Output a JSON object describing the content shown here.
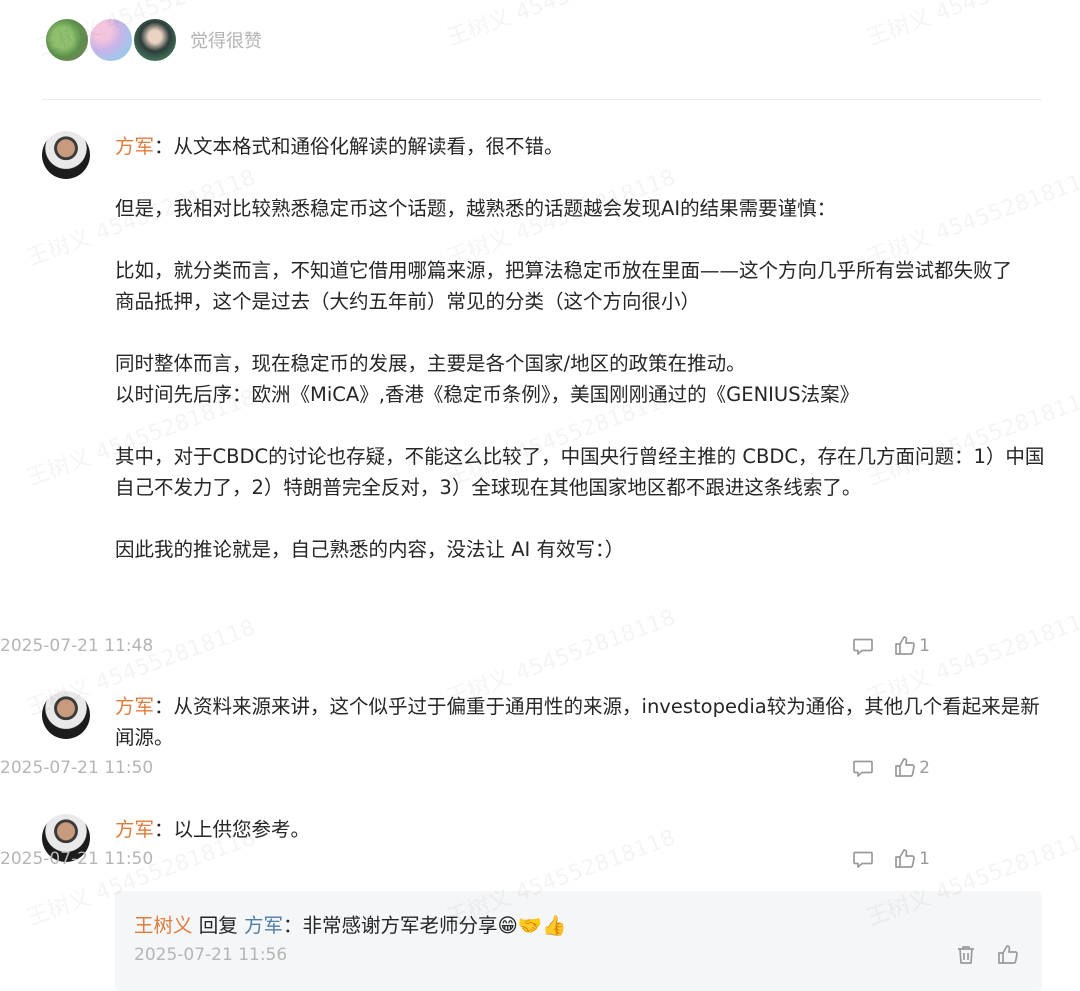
{
  "watermark": "王树义 454552818118",
  "likers": {
    "count_text": "觉得很赞",
    "avatars": [
      "liker-avatar-1",
      "liker-avatar-2",
      "liker-avatar-3"
    ]
  },
  "comments": [
    {
      "author": "方军",
      "separator": "：",
      "text": "从文本格式和通俗化解读的解读看，很不错。\n\n但是，我相对比较熟悉稳定币这个话题，越熟悉的话题越会发现AI的结果需要谨慎：\n\n比如，就分类而言，不知道它借用哪篇来源，把算法稳定币放在里面——这个方向几乎所有尝试都失败了\n商品抵押，这个是过去（大约五年前）常见的分类（这个方向很小）\n\n同时整体而言，现在稳定币的发展，主要是各个国家/地区的政策在推动。\n以时间先后序：欧洲《MiCA》,香港《稳定币条例》，美国刚刚通过的《GENIUS法案》\n\n其中，对于CBDC的讨论也存疑，不能这么比较了，中国央行曾经主推的 CBDC，存在几方面问题：1）中国自己不发力了，2）特朗普完全反对，3）全球现在其他国家地区都不跟进这条线索了。\n\n因此我的推论就是，自己熟悉的内容，没法让 AI 有效写：）",
      "time": "2025-07-21 11:48",
      "likes": "1"
    },
    {
      "author": "方军",
      "separator": "：",
      "text": "从资料来源来讲，这个似乎过于偏重于通用性的来源，investopedia较为通俗，其他几个看起来是新闻源。",
      "time": "2025-07-21 11:50",
      "likes": "2"
    },
    {
      "author": "方军",
      "separator": "：",
      "text": "以上供您参考。",
      "time": "2025-07-21 11:50",
      "likes": "1"
    }
  ],
  "reply": {
    "user": "王树义",
    "verb": "回复",
    "target": "方军",
    "separator": "：",
    "text": "非常感谢方军老师分享😁🤝👍",
    "time": "2025-07-21 11:56"
  },
  "icons": {
    "comment": "comment-bubble-icon",
    "like": "thumbs-up-icon",
    "delete": "trash-icon"
  },
  "colors": {
    "author": "#e07b3c",
    "reply_target": "#4f7fa6",
    "meta": "#b5b5b5",
    "reply_bg": "#f5f6f7"
  }
}
